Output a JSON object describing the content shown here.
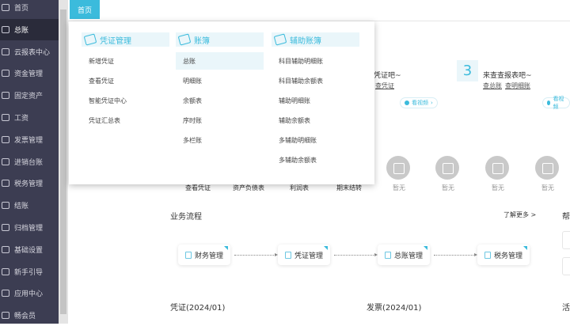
{
  "sidebar": {
    "items": [
      {
        "label": "首页",
        "icon": "home-icon"
      },
      {
        "label": "总账",
        "icon": "ledger-icon",
        "active": true
      },
      {
        "label": "云报表中心",
        "icon": "chart-icon"
      },
      {
        "label": "资金管理",
        "icon": "wallet-icon"
      },
      {
        "label": "固定资产",
        "icon": "building-icon"
      },
      {
        "label": "工资",
        "icon": "salary-icon"
      },
      {
        "label": "发票管理",
        "icon": "invoice-icon"
      },
      {
        "label": "进销台账",
        "icon": "inventory-icon"
      },
      {
        "label": "税务管理",
        "icon": "tax-icon"
      },
      {
        "label": "结账",
        "icon": "close-books-icon"
      },
      {
        "label": "归档管理",
        "icon": "archive-icon"
      },
      {
        "label": "基础设置",
        "icon": "gear-icon"
      },
      {
        "label": "新手引导",
        "icon": "guide-icon"
      },
      {
        "label": "应用中心",
        "icon": "apps-icon"
      },
      {
        "label": "畅会员",
        "icon": "vip-icon"
      }
    ]
  },
  "tabs": {
    "home": "首页"
  },
  "menu": {
    "columns": [
      {
        "title": "凭证管理",
        "items": [
          "新增凭证",
          "查看凭证",
          "智能凭证中心",
          "凭证汇总表"
        ]
      },
      {
        "title": "账簿",
        "items": [
          "总账",
          "明细账",
          "余额表",
          "序时账",
          "多栏账"
        ]
      },
      {
        "title": "辅助账簿",
        "items": [
          "科目辅助明细账",
          "科目辅助余额表",
          "辅助明细账",
          "辅助余额表",
          "多辅助明细账",
          "多辅助余额表"
        ]
      }
    ]
  },
  "steps": {
    "step2_text": "先凭证吧~",
    "step2_link": "查凭证",
    "video_label": "看视频",
    "step3_num": "3",
    "step3_text": "来查查报表吧~",
    "step3_link1": "查总账",
    "step3_link2": "查明细账",
    "video_label2": "看视频"
  },
  "shortcuts": [
    "查看凭证",
    "资产负债表",
    "利润表",
    "期末结转"
  ],
  "empty_label": "暂无",
  "process": {
    "title": "业务流程",
    "more": "了解更多 >",
    "nodes": [
      "财务管理",
      "凭证管理",
      "总账管理",
      "税务管理"
    ]
  },
  "help_title": "帮",
  "voucher_title": "凭证(2024/01)",
  "invoice_title": "发票(2024/01)",
  "activity_title": "活"
}
